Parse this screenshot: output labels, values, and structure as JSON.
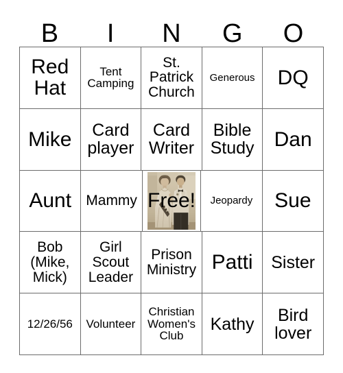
{
  "card": {
    "headers": [
      "B",
      "I",
      "N",
      "G",
      "O"
    ],
    "rows": [
      [
        {
          "text": "Red Hat",
          "size": "xl"
        },
        {
          "text": "Tent Camping",
          "size": "sm"
        },
        {
          "text": "St. Patrick Church",
          "size": "md"
        },
        {
          "text": "Generous",
          "size": "xs"
        },
        {
          "text": "DQ",
          "size": "xl"
        }
      ],
      [
        {
          "text": "Mike",
          "size": "xl"
        },
        {
          "text": "Card player",
          "size": "lg"
        },
        {
          "text": "Card Writer",
          "size": "lg"
        },
        {
          "text": "Bible Study",
          "size": "lg"
        },
        {
          "text": "Dan",
          "size": "xl"
        }
      ],
      [
        {
          "text": "Aunt",
          "size": "xl"
        },
        {
          "text": "Mammy",
          "size": "md"
        },
        {
          "text": "Free!",
          "size": "xl",
          "free": true,
          "image": "vintage-couple-photo"
        },
        {
          "text": "Jeopardy",
          "size": "xs"
        },
        {
          "text": "Sue",
          "size": "xl"
        }
      ],
      [
        {
          "text": "Bob (Mike, Mick)",
          "size": "md"
        },
        {
          "text": "Girl Scout Leader",
          "size": "md"
        },
        {
          "text": "Prison Ministry",
          "size": "md"
        },
        {
          "text": "Patti",
          "size": "xl"
        },
        {
          "text": "Sister",
          "size": "lg"
        }
      ],
      [
        {
          "text": "12/26/56",
          "size": "sm"
        },
        {
          "text": "Volunteer",
          "size": "sm"
        },
        {
          "text": "Christian Women's Club",
          "size": "sm"
        },
        {
          "text": "Kathy",
          "size": "lg"
        },
        {
          "text": "Bird lover",
          "size": "lg"
        }
      ]
    ]
  },
  "colors": {
    "grid_line": "#6b6b6b",
    "text": "#000000",
    "background": "#ffffff",
    "photo_sepia_light": "#e6ddc9",
    "photo_sepia_mid": "#b9a98c",
    "photo_sepia_dark": "#4a3f30"
  }
}
